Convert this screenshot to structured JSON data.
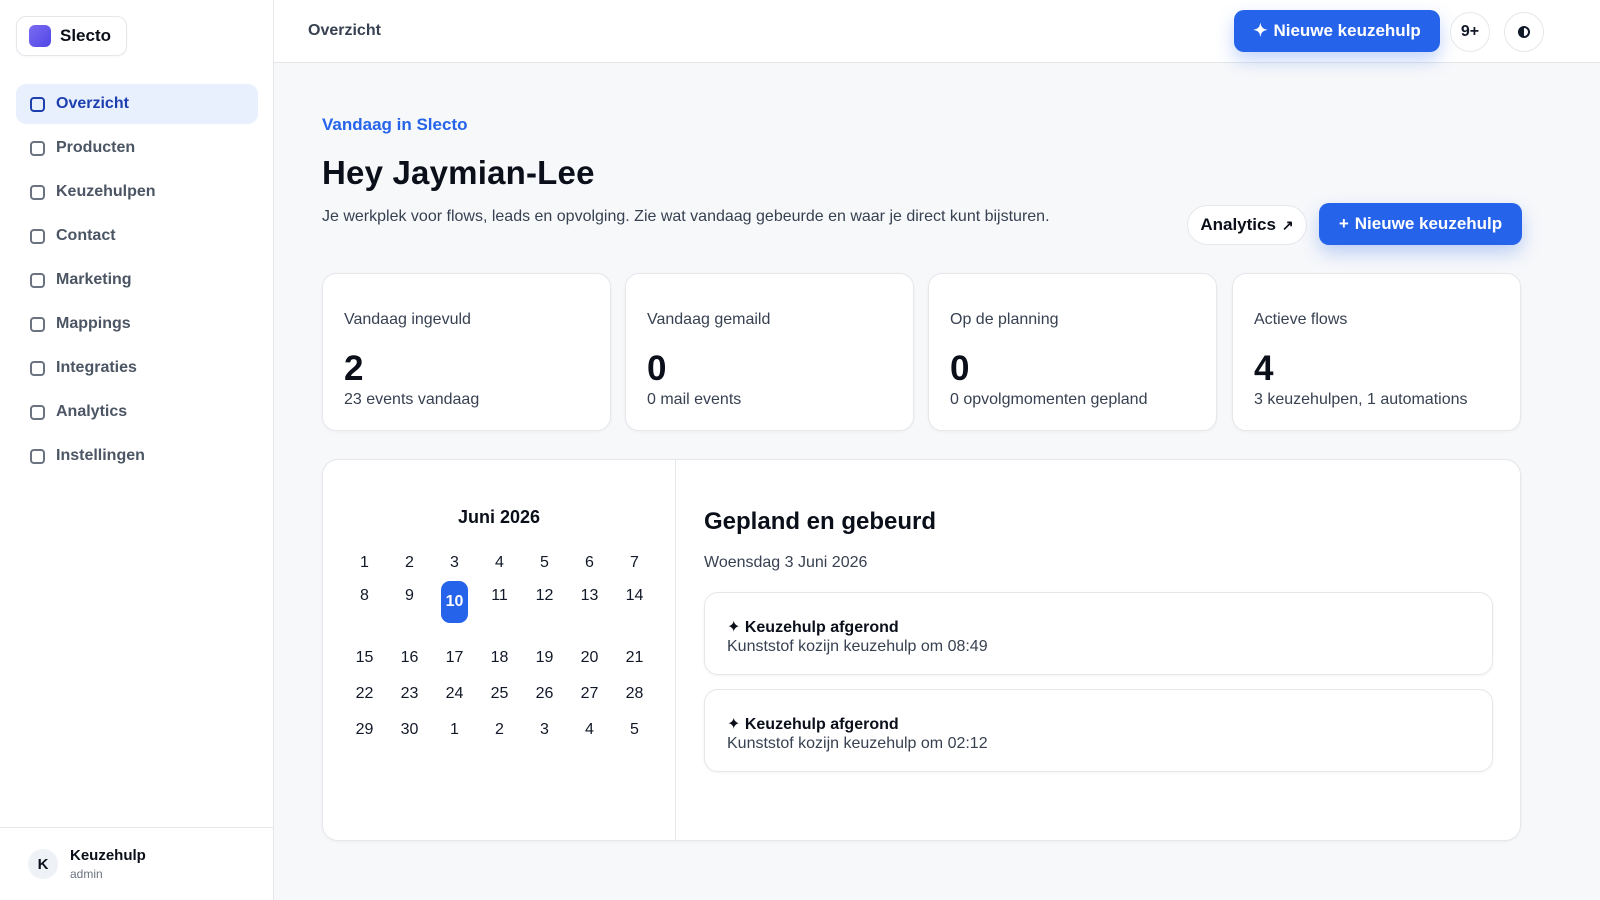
{
  "app": {
    "name": "Slecto"
  },
  "sidebar": {
    "items": [
      {
        "label": "Overzicht",
        "active": true
      },
      {
        "label": "Producten"
      },
      {
        "label": "Keuzehulpen"
      },
      {
        "label": "Contact"
      },
      {
        "label": "Marketing"
      },
      {
        "label": "Mappings"
      },
      {
        "label": "Integraties"
      },
      {
        "label": "Analytics"
      },
      {
        "label": "Instellingen"
      }
    ],
    "user": {
      "initial": "K",
      "name": "Keuzehulp",
      "role": "admin"
    }
  },
  "topbar": {
    "title": "Overzicht",
    "new_button_icon": "✦",
    "new_button_label": "Nieuwe keuzehulp",
    "notifications": "9+",
    "theme_icon": "half-circle-icon"
  },
  "hero": {
    "eyebrow": "Vandaag in Slecto",
    "title": "Hey Jaymian-Lee",
    "intro": "Je werkplek voor flows, leads en opvolging. Zie wat vandaag gebeurde en waar je direct kunt bijsturen.",
    "analytics_label": "Analytics",
    "analytics_icon": "↗",
    "new_icon": "+",
    "new_label": "Nieuwe keuzehulp"
  },
  "stats": [
    {
      "label": "Vandaag ingevuld",
      "value": "2",
      "sub": "23 events vandaag"
    },
    {
      "label": "Vandaag gemaild",
      "value": "0",
      "sub": "0 mail events"
    },
    {
      "label": "Op de planning",
      "value": "0",
      "sub": "0 opvolgmomenten gepland"
    },
    {
      "label": "Actieve flows",
      "value": "4",
      "sub": "3 keuzehulpen, 1 automations"
    }
  ],
  "calendar": {
    "title": "Juni 2026",
    "weeks": [
      [
        "1",
        "2",
        "3",
        "4",
        "5",
        "6",
        "7"
      ],
      [
        "8",
        "9",
        "10",
        "11",
        "12",
        "13",
        "14"
      ],
      [
        "15",
        "16",
        "17",
        "18",
        "19",
        "20",
        "21"
      ],
      [
        "22",
        "23",
        "24",
        "25",
        "26",
        "27",
        "28"
      ],
      [
        "29",
        "30",
        "1",
        "2",
        "3",
        "4",
        "5"
      ]
    ],
    "selected": "10"
  },
  "events": {
    "title": "Gepland en gebeurd",
    "date": "Woensdag 3 Juni 2026",
    "items": [
      {
        "title": "✦ Keuzehulp afgerond",
        "desc": "Kunststof kozijn keuzehulp om 08:49"
      },
      {
        "title": "✦ Keuzehulp afgerond",
        "desc": "Kunststof kozijn keuzehulp om 02:12"
      }
    ]
  },
  "colors": {
    "accent": "#2563eb",
    "active_nav_bg": "#e8f0fe",
    "brand_logo": "#5b4ee8"
  }
}
